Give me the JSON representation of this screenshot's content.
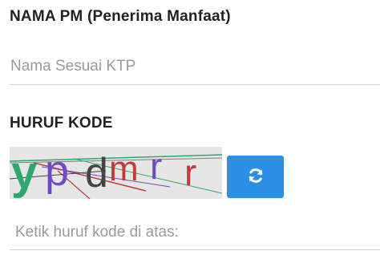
{
  "form": {
    "nama_label": "NAMA PM (Penerima Manfaat)",
    "nama_placeholder": "Nama Sesuai KTP",
    "kode_label": "HURUF KODE",
    "kode_placeholder": "Ketik huruf kode di atas:"
  },
  "captcha": {
    "characters": [
      {
        "char": "y",
        "color": "#2fa86f"
      },
      {
        "char": "p",
        "color": "#6f4ac8"
      },
      {
        "char": "d",
        "color": "#444444"
      },
      {
        "char": "m",
        "color": "#c23b3b"
      },
      {
        "char": "r",
        "color": "#6f4ac8"
      },
      {
        "char": "r",
        "color": "#c23b3b"
      }
    ]
  },
  "icons": {
    "refresh": "refresh-icon"
  },
  "colors": {
    "accent": "#2b8fe6",
    "divider": "#cfcfcf",
    "captcha_bg": "#e6e6e6"
  }
}
